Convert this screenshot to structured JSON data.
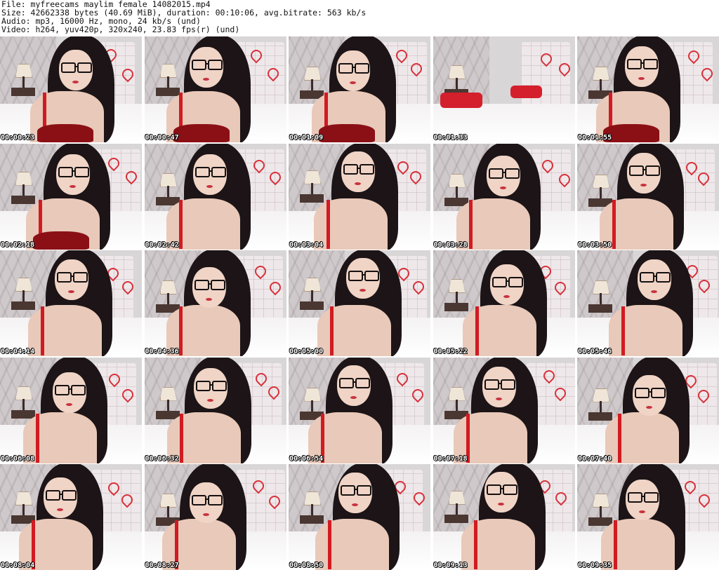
{
  "header": {
    "file": "File: myfreecams_maylim_female_14082015.mp4",
    "size": "Size: 42662338 bytes (40.69 MiB), duration: 00:10:06, avg.bitrate: 563 kb/s",
    "audio": "Audio: mp3, 16000 Hz, mono, 24 kb/s (und)",
    "video": "Video: h264, yuv420p, 320x240, 23.83 fps(r) (und)"
  },
  "thumbnails": [
    {
      "timestamp": "00:00:23"
    },
    {
      "timestamp": "00:00:47"
    },
    {
      "timestamp": "00:01:09"
    },
    {
      "timestamp": "00:01:33"
    },
    {
      "timestamp": "00:01:55"
    },
    {
      "timestamp": "00:02:18"
    },
    {
      "timestamp": "00:02:42"
    },
    {
      "timestamp": "00:03:04"
    },
    {
      "timestamp": "00:03:28"
    },
    {
      "timestamp": "00:03:50"
    },
    {
      "timestamp": "00:04:14"
    },
    {
      "timestamp": "00:04:36"
    },
    {
      "timestamp": "00:05:00"
    },
    {
      "timestamp": "00:05:22"
    },
    {
      "timestamp": "00:05:46"
    },
    {
      "timestamp": "00:06:08"
    },
    {
      "timestamp": "00:06:32"
    },
    {
      "timestamp": "00:06:54"
    },
    {
      "timestamp": "00:07:18"
    },
    {
      "timestamp": "00:07:40"
    },
    {
      "timestamp": "00:08:04"
    },
    {
      "timestamp": "00:08:27"
    },
    {
      "timestamp": "00:08:50"
    },
    {
      "timestamp": "00:09:13"
    },
    {
      "timestamp": "00:09:35"
    }
  ],
  "colors": {
    "background": "#ffffff",
    "header_text": "#111111",
    "timestamp_text": "#ffffff",
    "timestamp_outline": "#000000",
    "accent_red": "#d11b22"
  }
}
